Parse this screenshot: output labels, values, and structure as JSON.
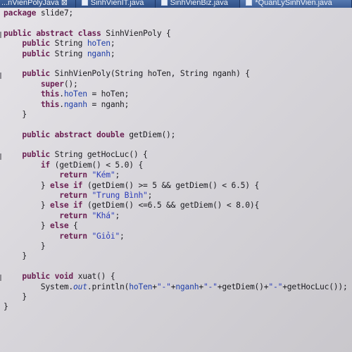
{
  "tabs": [
    {
      "label": "...nVienPolyJava ⊠"
    },
    {
      "label": "SinhVienIT.java"
    },
    {
      "label": "SinhVienBiz.java"
    },
    {
      "label": "*QuanLySinhVien.java"
    }
  ],
  "colors": {
    "keyword": "#6a1f52",
    "field": "#1f3ea8",
    "string": "#2a3bb8",
    "text": "#1b1b20",
    "tab_bar": "#2f4f86"
  },
  "code": [
    [
      {
        "t": "package",
        "k": "kw"
      },
      {
        "t": " slide7;"
      }
    ],
    [],
    [
      {
        "t": "public abstract class",
        "k": "kw"
      },
      {
        "t": " SinhVienPoly {"
      }
    ],
    [
      {
        "t": "    "
      },
      {
        "t": "public",
        "k": "kw"
      },
      {
        "t": " String "
      },
      {
        "t": "hoTen",
        "k": "fld"
      },
      {
        "t": ";"
      }
    ],
    [
      {
        "t": "    "
      },
      {
        "t": "public",
        "k": "kw"
      },
      {
        "t": " String "
      },
      {
        "t": "nganh",
        "k": "fld"
      },
      {
        "t": ";"
      }
    ],
    [],
    [
      {
        "t": "    "
      },
      {
        "t": "public",
        "k": "kw"
      },
      {
        "t": " SinhVienPoly(String hoTen, String nganh) {"
      }
    ],
    [
      {
        "t": "        "
      },
      {
        "t": "super",
        "k": "kw"
      },
      {
        "t": "();"
      }
    ],
    [
      {
        "t": "        "
      },
      {
        "t": "this",
        "k": "kw"
      },
      {
        "t": "."
      },
      {
        "t": "hoTen",
        "k": "fld"
      },
      {
        "t": " = hoTen;"
      }
    ],
    [
      {
        "t": "        "
      },
      {
        "t": "this",
        "k": "kw"
      },
      {
        "t": "."
      },
      {
        "t": "nganh",
        "k": "fld"
      },
      {
        "t": " = nganh;"
      }
    ],
    [
      {
        "t": "    }"
      }
    ],
    [],
    [
      {
        "t": "    "
      },
      {
        "t": "public abstract double",
        "k": "kw"
      },
      {
        "t": " getDiem();"
      }
    ],
    [],
    [
      {
        "t": "    "
      },
      {
        "t": "public",
        "k": "kw"
      },
      {
        "t": " String getHocLuc() {"
      }
    ],
    [
      {
        "t": "        "
      },
      {
        "t": "if",
        "k": "kw"
      },
      {
        "t": " (getDiem() < 5.0) {"
      }
    ],
    [
      {
        "t": "            "
      },
      {
        "t": "return",
        "k": "kw"
      },
      {
        "t": " "
      },
      {
        "t": "\"Kém\"",
        "k": "str"
      },
      {
        "t": ";"
      }
    ],
    [
      {
        "t": "        } "
      },
      {
        "t": "else if",
        "k": "kw"
      },
      {
        "t": " (getDiem() >= 5 && getDiem() < 6.5) {"
      }
    ],
    [
      {
        "t": "            "
      },
      {
        "t": "return",
        "k": "kw"
      },
      {
        "t": " "
      },
      {
        "t": "\"Trung Bình\"",
        "k": "str"
      },
      {
        "t": ";"
      }
    ],
    [
      {
        "t": "        } "
      },
      {
        "t": "else if",
        "k": "kw"
      },
      {
        "t": " (getDiem() <=6.5 && getDiem() < 8.0){"
      }
    ],
    [
      {
        "t": "            "
      },
      {
        "t": "return",
        "k": "kw"
      },
      {
        "t": " "
      },
      {
        "t": "\"Khá\"",
        "k": "str"
      },
      {
        "t": ";"
      }
    ],
    [
      {
        "t": "        } "
      },
      {
        "t": "else",
        "k": "kw"
      },
      {
        "t": " {"
      }
    ],
    [
      {
        "t": "            "
      },
      {
        "t": "return",
        "k": "kw"
      },
      {
        "t": " "
      },
      {
        "t": "\"Giỏi\"",
        "k": "str"
      },
      {
        "t": ";"
      }
    ],
    [
      {
        "t": "        }"
      }
    ],
    [
      {
        "t": "    }"
      }
    ],
    [],
    [
      {
        "t": "    "
      },
      {
        "t": "public void",
        "k": "kw"
      },
      {
        "t": " xuat() {"
      }
    ],
    [
      {
        "t": "        System."
      },
      {
        "t": "out",
        "k": "sta"
      },
      {
        "t": ".println("
      },
      {
        "t": "hoTen",
        "k": "fld"
      },
      {
        "t": "+"
      },
      {
        "t": "\"-\"",
        "k": "str"
      },
      {
        "t": "+"
      },
      {
        "t": "nganh",
        "k": "fld"
      },
      {
        "t": "+"
      },
      {
        "t": "\"-\"",
        "k": "str"
      },
      {
        "t": "+getDiem()+"
      },
      {
        "t": "\"-\"",
        "k": "str"
      },
      {
        "t": "+getHocLuc());"
      }
    ],
    [
      {
        "t": "    }"
      }
    ],
    [
      {
        "t": "}"
      }
    ]
  ]
}
